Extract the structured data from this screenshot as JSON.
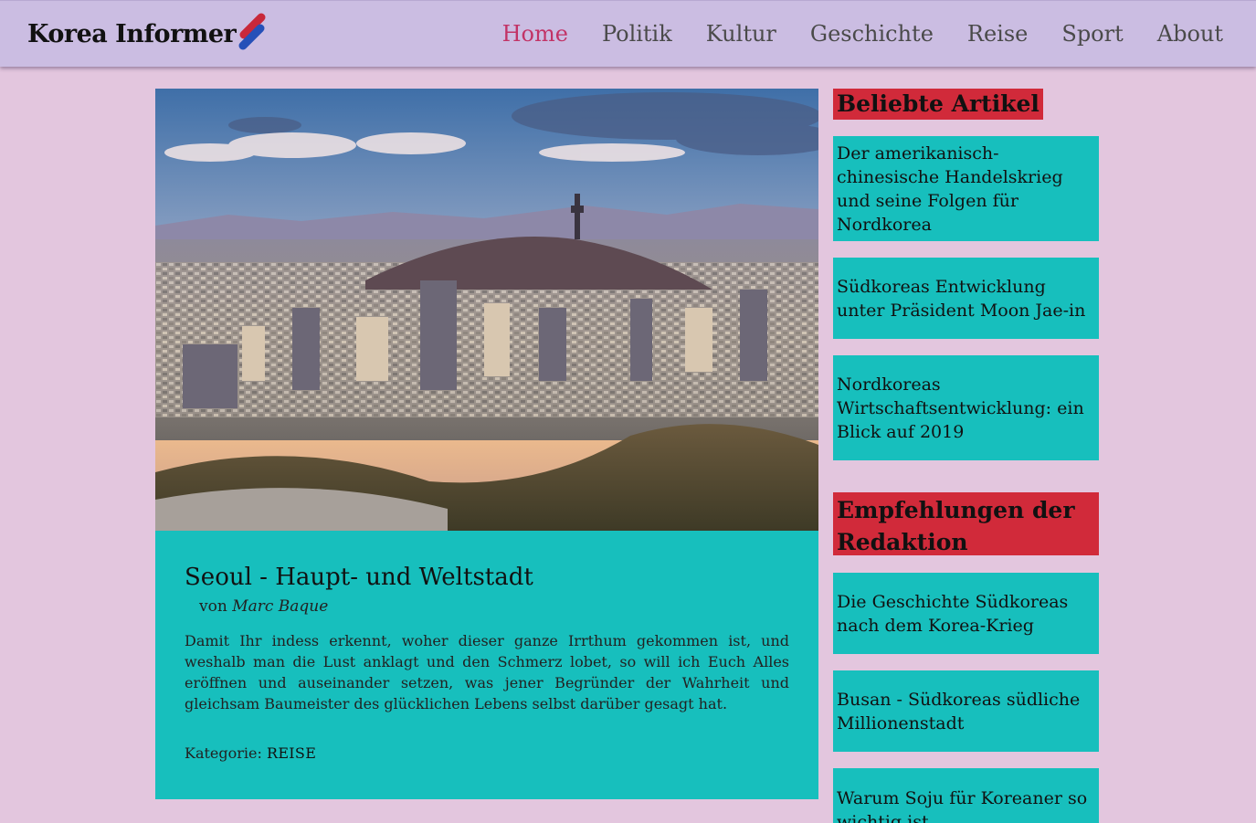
{
  "site": {
    "logo_text": "Korea Informer"
  },
  "nav": {
    "items": [
      {
        "label": "Home",
        "active": true
      },
      {
        "label": "Politik"
      },
      {
        "label": "Kultur"
      },
      {
        "label": "Geschichte"
      },
      {
        "label": "Reise"
      },
      {
        "label": "Sport"
      },
      {
        "label": "About"
      }
    ]
  },
  "article": {
    "title": "Seoul - Haupt- und Weltstadt",
    "byline_prefix": "von",
    "author": "Marc Baque",
    "excerpt": "Damit Ihr indess erkennt, woher dieser ganze Irrthum gekommen ist, und weshalb man die Lust anklagt und den Schmerz lobet, so will ich Euch Alles eröffnen und auseinander setzen, was jener Begründer der Wahrheit und gleichsam Baumeister des glücklichen Lebens selbst darüber gesagt hat.",
    "category_label": "Kategorie:",
    "category": "REISE"
  },
  "sidebar": {
    "popular_heading": "Beliebte Artikel",
    "popular": [
      "Der amerikanisch-chinesische Handelskrieg und seine Folgen für Nordkorea",
      "Südkoreas Entwicklung unter Präsident Moon Jae-in",
      "Nordkoreas Wirtschaftsentwicklung: ein Blick auf 2019"
    ],
    "editors_heading": "Empfehlungen der Redaktion",
    "editors": [
      "Die Geschichte Südkoreas nach dem Korea-Krieg",
      "Busan - Südkoreas südliche Millionenstadt",
      "Warum Soju für Koreaner so wichtig ist"
    ]
  },
  "colors": {
    "page_bg": "#e3c6de",
    "header_bg": "#cbbde2",
    "accent_teal": "#17bfbd",
    "heading_red": "#d12a3a",
    "nav_active": "#c23366"
  }
}
